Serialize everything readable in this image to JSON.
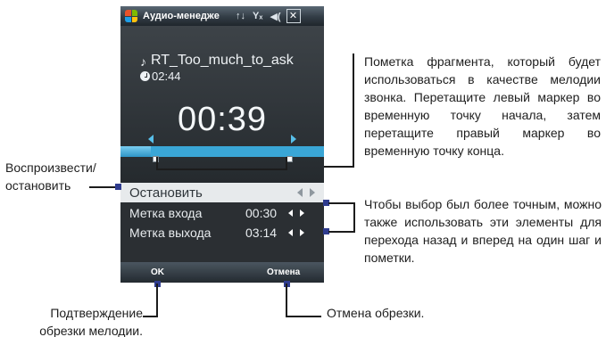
{
  "window": {
    "title": "Аудио-менеджe",
    "signal_glyph": "↑↓",
    "network_glyph": "Yₓ",
    "volume_glyph": "◀(",
    "close_label": "✕"
  },
  "track": {
    "name": "RT_Too_much_to_ask",
    "duration": "02:44",
    "elapsed": "00:39",
    "note_glyph": "♪"
  },
  "timeline": {
    "played_fraction": 0.15,
    "start_marker_fraction": 0.17,
    "end_marker_fraction": 0.83
  },
  "controls": {
    "stop_label": "Остановить",
    "mark_in_label": "Метка входа",
    "mark_in_time": "00:30",
    "mark_out_label": "Метка выхода",
    "mark_out_time": "03:14"
  },
  "softkeys": {
    "ok_label": "OK",
    "cancel_label": "Отмена"
  },
  "annotations": {
    "play_stop": "Воспроизвести/ остановить",
    "fragment_marking": "Пометка фрагмента, который будет использоваться в качестве мелодии звонка. Перетащите левый маркер во временную точку начала, затем перетащите правый маркер во временную точку конца.",
    "step_controls": "Чтобы выбор был более точным, можно также использовать эти элементы для перехода назад и вперед на один шаг и пометки.",
    "confirm_trim": "Подтверждение обрезки мелодии.",
    "cancel_trim": "Отмена обрезки."
  },
  "colors": {
    "accent": "#3aa6d6",
    "callout_marker": "#2f3c8f"
  }
}
